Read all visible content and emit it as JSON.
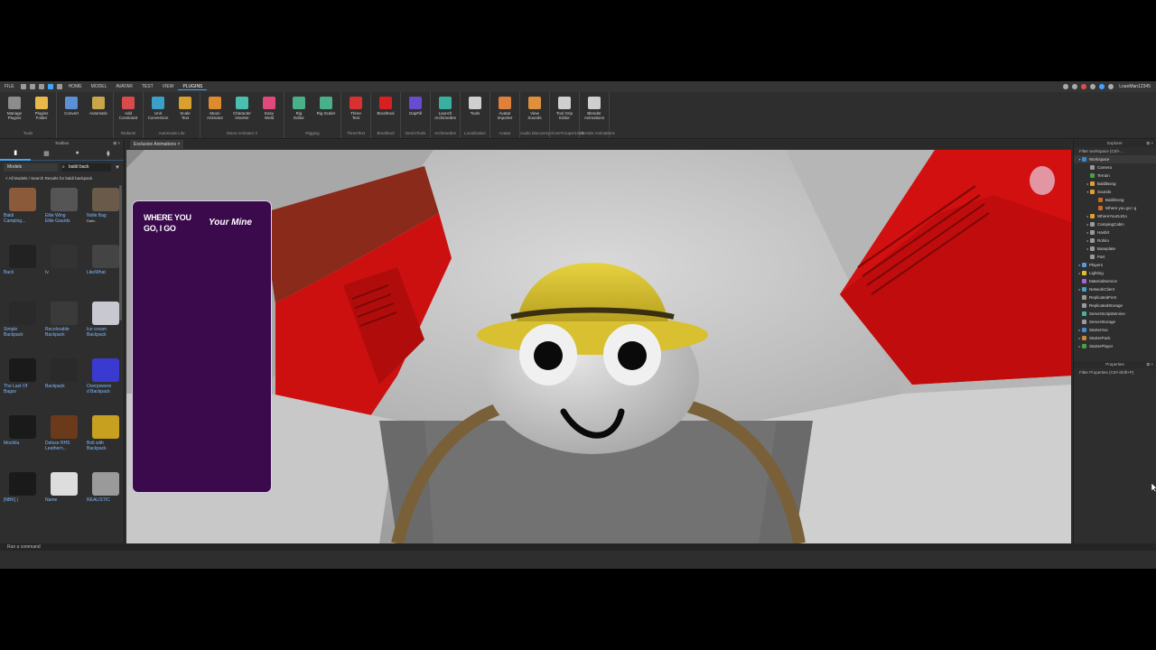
{
  "menu": {
    "file": "FILE",
    "tabs": [
      "HOME",
      "MODEL",
      "AVATAR",
      "TEST",
      "VIEW",
      "PLUGINS"
    ],
    "active_tab": "PLUGINS",
    "user": "LoanMan12345"
  },
  "ribbon": {
    "groups": [
      {
        "name": "Tools",
        "buttons": [
          {
            "label": "Manage\nPlugins",
            "icon": "manage-plugins-icon",
            "color": "#8c8c8c"
          },
          {
            "label": "Plugins\nFolder",
            "icon": "folder-icon",
            "color": "#e8b84a"
          }
        ]
      },
      {
        "name": "",
        "buttons": [
          {
            "label": "Convert",
            "icon": "convert-icon",
            "color": "#5b8fd6"
          },
          {
            "label": "Automatic",
            "icon": "automatic-icon",
            "color": "#c9a64a"
          }
        ]
      },
      {
        "name": "Redacts",
        "buttons": [
          {
            "label": "Add\nConstraint",
            "icon": "constraint-icon",
            "color": "#d94a4a"
          }
        ]
      },
      {
        "name": "AutoScale Lite",
        "buttons": [
          {
            "label": "Unit\nConversion",
            "icon": "unit-conversion-icon",
            "color": "#3aa0c8"
          },
          {
            "label": "Scale\nText",
            "icon": "scale-text-icon",
            "color": "#d9a030"
          }
        ]
      },
      {
        "name": "Moon Animator 2",
        "buttons": [
          {
            "label": "Moon\nAnimator",
            "icon": "moon-icon",
            "color": "#e08a30"
          },
          {
            "label": "Character\nInserter",
            "icon": "character-inserter-icon",
            "color": "#4ac0b0"
          },
          {
            "label": "Easy\nWeld",
            "icon": "weld-icon",
            "color": "#e04a7a"
          }
        ]
      },
      {
        "name": "Rigging",
        "buttons": [
          {
            "label": "Rig\nEditor",
            "icon": "rig-editor-icon",
            "color": "#4ab08a"
          },
          {
            "label": "Rig Scaler",
            "icon": "rig-scaler-icon",
            "color": "#4ab08a"
          }
        ]
      },
      {
        "name": "ThreeText",
        "buttons": [
          {
            "label": "Three\nText",
            "icon": "three-text-icon",
            "color": "#d93030"
          }
        ]
      },
      {
        "name": "Brushtool",
        "buttons": [
          {
            "label": "Brushtool",
            "icon": "brush-icon",
            "color": "#d92020"
          }
        ]
      },
      {
        "name": "GeomTools",
        "buttons": [
          {
            "label": "GapFill",
            "icon": "gapfill-icon",
            "color": "#6a4ad0"
          }
        ]
      },
      {
        "name": "Archimedes",
        "buttons": [
          {
            "label": "Launch\nArchimedes",
            "icon": "archimedes-icon",
            "color": "#3ab0a0"
          }
        ]
      },
      {
        "name": "Localization",
        "buttons": [
          {
            "label": "Tools",
            "icon": "tools-icon",
            "color": "#cfcfcf"
          }
        ]
      },
      {
        "name": "Avatar",
        "buttons": [
          {
            "label": "Avatar\nImporter",
            "icon": "avatar-importer-icon",
            "color": "#e0803a"
          }
        ]
      },
      {
        "name": "Audio Discovery",
        "buttons": [
          {
            "label": "View\nSounds",
            "icon": "sound-icon",
            "color": "#e0903a"
          }
        ]
      },
      {
        "name": "CloneTrooper1019",
        "buttons": [
          {
            "label": "Tool Grip\nEditor",
            "icon": "tool-grip-icon",
            "color": "#cfcfcf"
          }
        ]
      },
      {
        "name": "Blender Animations",
        "buttons": [
          {
            "label": "Blender\nAnimations",
            "icon": "blender-icon",
            "color": "#cfcfcf"
          }
        ]
      }
    ]
  },
  "toolbox": {
    "title": "Toolbox",
    "category": "Models",
    "search_value": "baldi back",
    "breadcrumb": "< All Models / Search Results for baldi backpack",
    "items": [
      {
        "name": "Baldi\nCamping...",
        "color": "#8a5a3a"
      },
      {
        "name": "Elite Wing\nElite Gaurds",
        "color": "#555"
      },
      {
        "name": "Nolle Bag",
        "color": "#6a5a4a",
        "sub": "Ratio"
      },
      {
        "name": "Back",
        "color": "#222"
      },
      {
        "name": "Iv",
        "color": "#333"
      },
      {
        "name": "LikeWhat",
        "color": "#444"
      },
      {
        "name": "Simple\nBackpack",
        "color": "#2a2a2a"
      },
      {
        "name": "Recolorable\nBackpack",
        "color": "#3a3a3a"
      },
      {
        "name": "Ice cream\nBackpack",
        "color": "#c8c8d0"
      },
      {
        "name": "The Last Of\nBagss",
        "color": "#1a1a1a"
      },
      {
        "name": "Backpack",
        "color": "#2a2a2a"
      },
      {
        "name": "Overpowere\nd Backpack",
        "color": "#3a3ad0"
      },
      {
        "name": "Mochila",
        "color": "#1a1a1a"
      },
      {
        "name": "Deluxe RHS\nLeathern...",
        "color": "#6a3a1a"
      },
      {
        "name": "Bolt with\nBackpack",
        "color": "#c8a020"
      },
      {
        "name": "[NBK] |",
        "color": "#1a1a1a"
      },
      {
        "name": "Name",
        "color": "#ddd"
      },
      {
        "name": "REALISTIC",
        "color": "#9a9a9a"
      }
    ]
  },
  "viewport": {
    "tab": "Exclusive Animations",
    "gui_line1": "WHERE YOU\nGO, I GO",
    "gui_line2": "Your Mine"
  },
  "explorer": {
    "title": "Explorer",
    "filter": "Filter workspace (Ctrl+...",
    "rows": [
      {
        "label": "Workspace",
        "indent": 0,
        "arrow": "▾",
        "color": "#3a8ad0",
        "selected": true
      },
      {
        "label": "Camera",
        "indent": 1,
        "arrow": "",
        "color": "#9a9a9a"
      },
      {
        "label": "Terrain",
        "indent": 1,
        "arrow": "",
        "color": "#4aa04a"
      },
      {
        "label": "BaldiBong",
        "indent": 1,
        "arrow": "▸",
        "color": "#e0a030"
      },
      {
        "label": "Sounds",
        "indent": 1,
        "arrow": "▾",
        "color": "#e0a030"
      },
      {
        "label": "BaldiSong",
        "indent": 2,
        "arrow": "",
        "color": "#c86a2a"
      },
      {
        "label": "Where you go I g",
        "indent": 2,
        "arrow": "",
        "color": "#c86a2a"
      },
      {
        "label": "WhereYouGoGo",
        "indent": 1,
        "arrow": "▸",
        "color": "#e0a030"
      },
      {
        "label": "CampingCabin",
        "indent": 1,
        "arrow": "▸",
        "color": "#9a9a9a"
      },
      {
        "label": "Hasbrt",
        "indent": 1,
        "arrow": "▸",
        "color": "#9a9a9a"
      },
      {
        "label": "Rohito",
        "indent": 1,
        "arrow": "▸",
        "color": "#9a9a9a"
      },
      {
        "label": "Baseplate",
        "indent": 1,
        "arrow": "▸",
        "color": "#9a9a9a"
      },
      {
        "label": "Part",
        "indent": 1,
        "arrow": "",
        "color": "#9a9a9a"
      },
      {
        "label": "Players",
        "indent": 0,
        "arrow": "▸",
        "color": "#5a9ad0"
      },
      {
        "label": "Lighting",
        "indent": 0,
        "arrow": "▸",
        "color": "#e0c030"
      },
      {
        "label": "MaterialService",
        "indent": 0,
        "arrow": "",
        "color": "#a06ad0"
      },
      {
        "label": "NetworkClient",
        "indent": 0,
        "arrow": "▸",
        "color": "#4aa0c0"
      },
      {
        "label": "ReplicatedFirst",
        "indent": 0,
        "arrow": "",
        "color": "#9a9a9a"
      },
      {
        "label": "ReplicatedStorage",
        "indent": 0,
        "arrow": "",
        "color": "#9a9a9a"
      },
      {
        "label": "ServerScriptService",
        "indent": 0,
        "arrow": "",
        "color": "#4ab0a0"
      },
      {
        "label": "ServerStorage",
        "indent": 0,
        "arrow": "",
        "color": "#9a9a9a"
      },
      {
        "label": "StarterGui",
        "indent": 0,
        "arrow": "▸",
        "color": "#4a8ad0"
      },
      {
        "label": "StarterPack",
        "indent": 0,
        "arrow": "▸",
        "color": "#c08a3a"
      },
      {
        "label": "StarterPlayer",
        "indent": 0,
        "arrow": "▸",
        "color": "#4aa04a"
      }
    ]
  },
  "properties": {
    "title": "Properties",
    "filter": "Filter Properties (Ctrl+Shift+P)"
  },
  "command_bar": {
    "placeholder": "Run a command"
  }
}
